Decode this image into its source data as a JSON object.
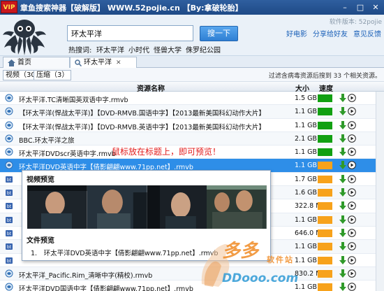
{
  "window": {
    "badge": "VIP",
    "title": "章鱼搜索神器【破解版】 WWW.52pojie.cn 【By:拿破轮胎】",
    "controls": [
      "–",
      "□",
      "✕"
    ]
  },
  "header": {
    "version": "软件版本: 52pojie",
    "search_value": "环太平洋",
    "search_button": "搜一下",
    "hot_label": "热搜词:",
    "hot_words": [
      "环太平洋",
      "小时代",
      "怪兽大学",
      "侏罗纪公园"
    ],
    "links": [
      "好电影",
      "分享给好友",
      "意见反馈"
    ]
  },
  "tabs": [
    {
      "label": "首页",
      "icon": "home-icon"
    },
    {
      "label": "环太平洋",
      "icon": "search-icon",
      "close": "✕"
    }
  ],
  "filters": {
    "video": "视频（30）",
    "archive": "压缩（3）",
    "info": "过滤含病毒资源后搜到 33 个相关资源。"
  },
  "table": {
    "headers": {
      "name": "资源名称",
      "size": "大小",
      "speed": "速度"
    },
    "rows": [
      {
        "name": "环太平洋.TC清晰国英双语中字.rmvb",
        "size": "1.5 GB",
        "speed": "green",
        "icon": "emule-icon"
      },
      {
        "name": "【环太平洋(悍战太平洋)】【DVD-RMVB.国语中字】【2013最新美国科幻动作大片】",
        "size": "1.1 GB",
        "speed": "green",
        "icon": "emule-icon"
      },
      {
        "name": "【环太平洋(悍战太平洋)】【DVD-RMVB.英语中字】【2013最新美国科幻动作大片】",
        "size": "1.1 GB",
        "speed": "green",
        "icon": "emule-icon"
      },
      {
        "name": "BBC.环太平洋之旅",
        "size": "2.1 GB",
        "speed": "green",
        "icon": "emule-icon"
      },
      {
        "name": "环太平洋DVDscr英语中字.rmvb",
        "size": "1.1 GB",
        "speed": "green",
        "icon": "emule-icon"
      },
      {
        "name": "环太平洋DVD英语中字【倩影翩翩www.71pp.net】.rmvb",
        "size": "1.1 GB",
        "speed": "orange",
        "icon": "emule-icon",
        "selected": true
      },
      {
        "name": "",
        "size": "1.7 GB",
        "speed": "orange",
        "icon": "bt-icon"
      },
      {
        "name": "",
        "size": "1.6 GB",
        "speed": "orange",
        "icon": "bt-icon"
      },
      {
        "name": "",
        "size": "322.8 MB",
        "speed": "orange",
        "icon": "bt-icon"
      },
      {
        "name": "",
        "size": "1.1 GB",
        "speed": "orange",
        "icon": "bt-icon"
      },
      {
        "name": "",
        "size": "646.0 MB",
        "speed": "orange",
        "icon": "bt-icon"
      },
      {
        "name": "",
        "size": "1.1 GB",
        "speed": "orange",
        "icon": "bt-icon"
      },
      {
        "name": "",
        "size": "1.1 GB",
        "speed": "orange",
        "icon": "bt-icon"
      },
      {
        "name": "环太平洋_Pacific.Rim_清晰中字(精校).rmvb",
        "size": "830.2 MB",
        "speed": "orange",
        "icon": "emule-icon"
      },
      {
        "name": "环太平洋DVD国语中字【倩影翩翩www.71pp.net】.rmvb",
        "size": "1.1 GB",
        "speed": "orange",
        "icon": "emule-icon"
      }
    ]
  },
  "hint": "鼠标放在标题上，即可预览！",
  "popup": {
    "preview_title": "视频预览",
    "files_title": "文件预览",
    "file_item": "1.　环太平洋DVD英语中字【倩影翩翩www.71pp.net】.rmvb"
  },
  "watermark": {
    "text": "多多",
    "sub": "软件站",
    "domain": "DDooo.com"
  },
  "colors": {
    "accent": "#2e8ee8",
    "speed_good": "#12a012",
    "speed_mid": "#f7a21b",
    "hint": "#e21b1b"
  }
}
